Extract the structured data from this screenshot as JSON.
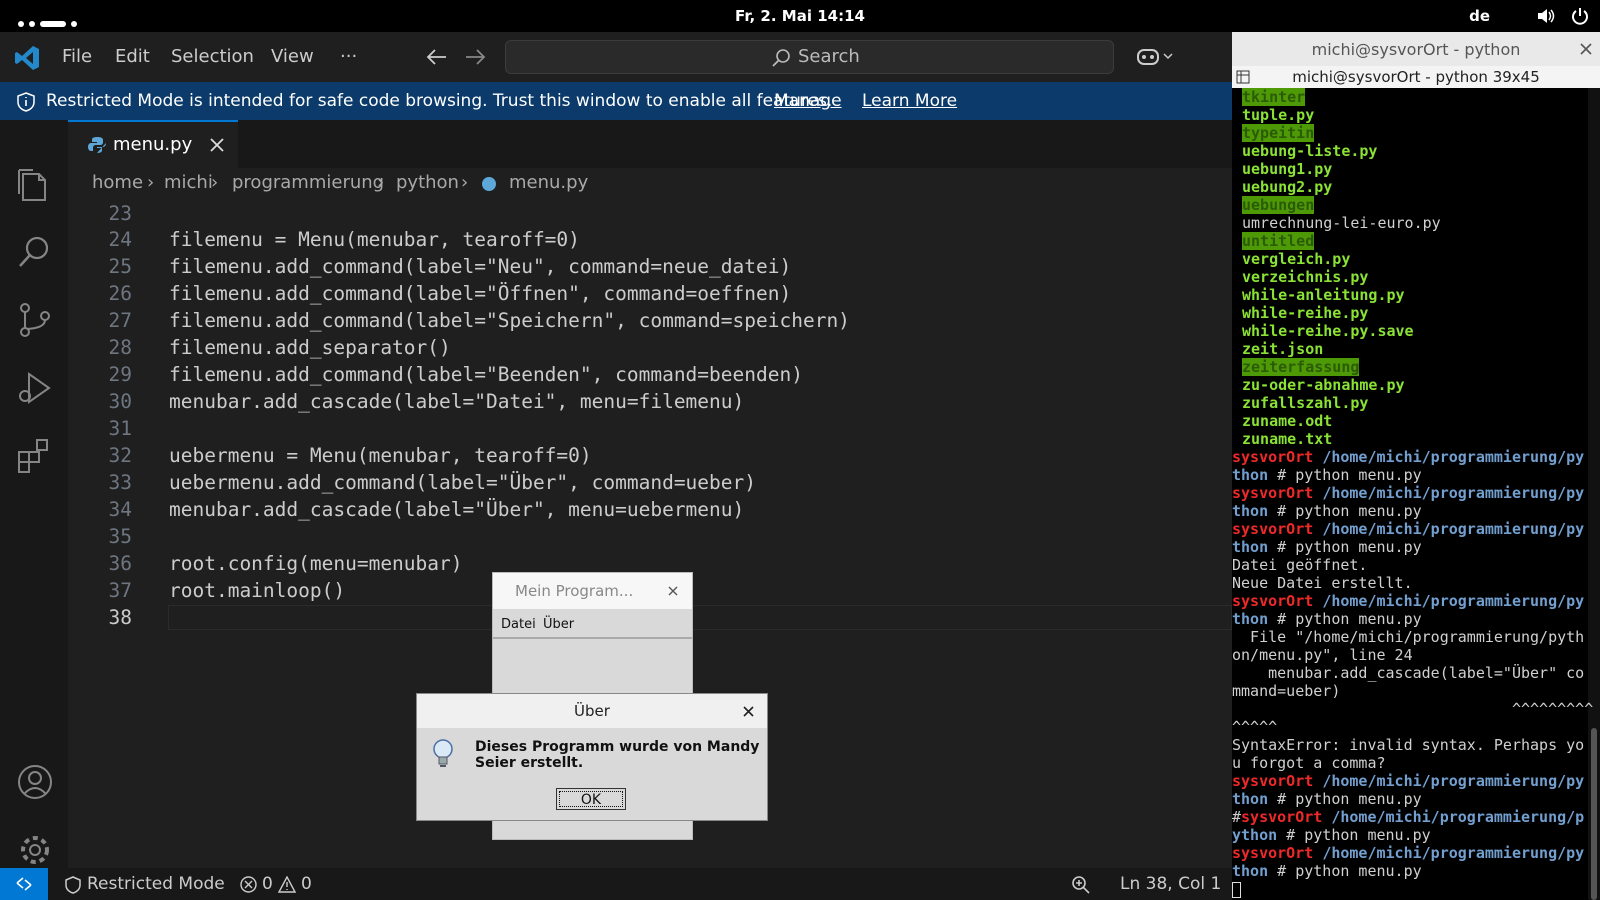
{
  "topbar": {
    "clock": "Fr, 2. Mai  14:14",
    "lang": "de"
  },
  "vscode": {
    "menus": [
      "File",
      "Edit",
      "Selection",
      "View",
      "···"
    ],
    "search_placeholder": "Search",
    "banner": {
      "text": "Restricted Mode is intended for safe code browsing. Trust this window to enable all features.",
      "manage": "Manage",
      "learn_more": "Learn More"
    },
    "tab": {
      "label": "menu.py"
    },
    "breadcrumb": [
      "home",
      "michi",
      "programmierung",
      "python",
      "menu.py"
    ],
    "code_lines": [
      {
        "n": "23",
        "text": ""
      },
      {
        "n": "24",
        "text": "filemenu = Menu(menubar, tearoff=0)"
      },
      {
        "n": "25",
        "text": "filemenu.add_command(label=\"Neu\", command=neue_datei)"
      },
      {
        "n": "26",
        "text": "filemenu.add_command(label=\"Öffnen\", command=oeffnen)"
      },
      {
        "n": "27",
        "text": "filemenu.add_command(label=\"Speichern\", command=speichern)"
      },
      {
        "n": "28",
        "text": "filemenu.add_separator()"
      },
      {
        "n": "29",
        "text": "filemenu.add_command(label=\"Beenden\", command=beenden)"
      },
      {
        "n": "30",
        "text": "menubar.add_cascade(label=\"Datei\", menu=filemenu)"
      },
      {
        "n": "31",
        "text": ""
      },
      {
        "n": "32",
        "text": "uebermenu = Menu(menubar, tearoff=0)"
      },
      {
        "n": "33",
        "text": "uebermenu.add_command(label=\"Über\", command=ueber)"
      },
      {
        "n": "34",
        "text": "menubar.add_cascade(label=\"Über\", menu=uebermenu)"
      },
      {
        "n": "35",
        "text": ""
      },
      {
        "n": "36",
        "text": "root.config(menu=menubar)"
      },
      {
        "n": "37",
        "text": "root.mainloop()"
      },
      {
        "n": "38",
        "text": ""
      }
    ],
    "status": {
      "mode": "Restricted Mode",
      "errors": "0",
      "warnings": "0",
      "position": "Ln 38, Col 1"
    }
  },
  "terminal": {
    "title": "michi@sysvorOrt - python",
    "subtitle": "michi@sysvorOrt - python 39x45",
    "lines": [
      {
        "t": "tkinter",
        "c": "dir"
      },
      {
        "t": "tuple.py",
        "c": "file"
      },
      {
        "t": "typeitin",
        "c": "dir"
      },
      {
        "t": "uebung-liste.py",
        "c": "file"
      },
      {
        "t": "uebung1.py",
        "c": "file"
      },
      {
        "t": "uebung2.py",
        "c": "file"
      },
      {
        "t": "uebungen",
        "c": "dir"
      },
      {
        "t": "umrechnung-lei-euro.py",
        "c": "plain"
      },
      {
        "t": "untitled",
        "c": "dir"
      },
      {
        "t": "vergleich.py",
        "c": "file"
      },
      {
        "t": "verzeichnis.py",
        "c": "file"
      },
      {
        "t": "while-anleitung.py",
        "c": "file"
      },
      {
        "t": "while-reihe.py",
        "c": "file"
      },
      {
        "t": "while-reihe.py.save",
        "c": "file"
      },
      {
        "t": "zeit.json",
        "c": "file"
      },
      {
        "t": "zeiterfassung",
        "c": "dir"
      },
      {
        "t": "zu-oder-abnahme.py",
        "c": "file"
      },
      {
        "t": "zufallszahl.py",
        "c": "file"
      },
      {
        "t": "zuname.odt",
        "c": "file"
      },
      {
        "t": "zuname.txt",
        "c": "file"
      }
    ],
    "prompt_host": "sysvorOrt",
    "prompt_path": "/home/michi/programmierung/py",
    "prompt_path_cont": "thon",
    "prompt_cmd": " # python menu.py",
    "out1": "Datei geöffnet.",
    "out2": "Neue Datei erstellt.",
    "err": [
      "  File \"/home/michi/programmierung/pyth",
      "on/menu.py\", line 24",
      "    menubar.add_cascade(label=\"Über\" co",
      "mmand=ueber)",
      "                               ^^^^^^^^^",
      "^^^^^",
      "SyntaxError: invalid syntax. Perhaps yo",
      "u forgot a comma?"
    ],
    "hash_prefix": "#",
    "prompt_path_b": "/home/michi/programmierung/p",
    "prompt_path_b_cont": "ython"
  },
  "tk_window": {
    "title": "Mein Program...",
    "menu": [
      "Datei",
      "Über"
    ]
  },
  "dialog": {
    "title": "Über",
    "message": "Dieses Programm wurde von Mandy Seier erstellt.",
    "ok": "OK"
  }
}
